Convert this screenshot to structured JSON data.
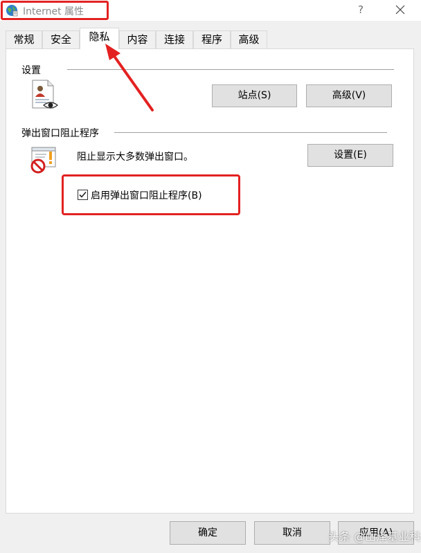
{
  "window": {
    "title": "Internet 属性",
    "help_label": "?"
  },
  "tabs": [
    {
      "label": "常规"
    },
    {
      "label": "安全"
    },
    {
      "label": "隐私"
    },
    {
      "label": "内容"
    },
    {
      "label": "连接"
    },
    {
      "label": "程序"
    },
    {
      "label": "高级"
    }
  ],
  "active_tab": "隐私",
  "settings_group": {
    "title": "设置",
    "sites_button": "站点(S)",
    "advanced_button": "高级(V)"
  },
  "popup_group": {
    "title": "弹出窗口阻止程序",
    "description": "阻止显示大多数弹出窗口。",
    "settings_button": "设置(E)",
    "checkbox_label": "启用弹出窗口阻止程序(B)",
    "checkbox_checked": true
  },
  "footer": {
    "ok": "确定",
    "cancel": "取消",
    "apply": "应用(A)"
  },
  "watermark": "头条 @山泽基业科技",
  "colors": {
    "annotation": "#e32121",
    "button_face": "#e1e1e1",
    "button_border": "#adadad",
    "dialog_bg": "#f0f0f0"
  }
}
